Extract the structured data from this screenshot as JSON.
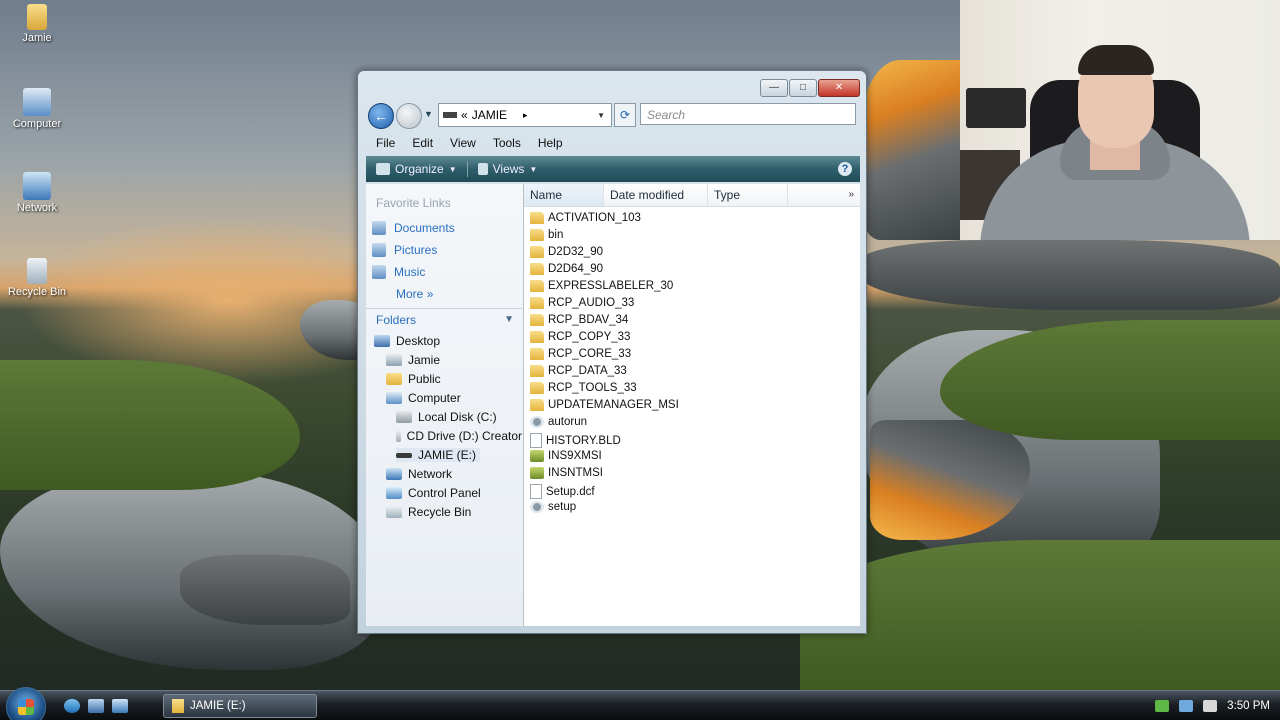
{
  "desktop": {
    "icons": [
      {
        "label": "Jamie",
        "icon": "user-folder-icon"
      },
      {
        "label": "Computer",
        "icon": "computer-icon"
      },
      {
        "label": "Network",
        "icon": "network-icon"
      },
      {
        "label": "Recycle Bin",
        "icon": "recycle-bin-icon"
      }
    ]
  },
  "window": {
    "caption_buttons": {
      "minimize": "—",
      "maximize": "□",
      "close": "✕"
    },
    "address": {
      "prefix": "«",
      "location": "JAMIE",
      "separator": "▸"
    },
    "search": {
      "placeholder": "Search"
    },
    "menu": [
      "File",
      "Edit",
      "View",
      "Tools",
      "Help"
    ],
    "toolbar": {
      "organize": "Organize",
      "views": "Views",
      "help": "?"
    },
    "favorite_links": {
      "title": "Favorite Links",
      "items": [
        "Documents",
        "Pictures",
        "Music"
      ],
      "more": "More"
    },
    "folders": {
      "title": "Folders",
      "tree": [
        {
          "label": "Desktop"
        },
        {
          "label": "Jamie"
        },
        {
          "label": "Public"
        },
        {
          "label": "Computer"
        },
        {
          "label": "Local Disk (C:)"
        },
        {
          "label": "CD Drive (D:) Creator"
        },
        {
          "label": "JAMIE (E:)"
        },
        {
          "label": "Network"
        },
        {
          "label": "Control Panel"
        },
        {
          "label": "Recycle Bin"
        }
      ]
    },
    "columns": [
      "Name",
      "Date modified",
      "Type"
    ],
    "files": [
      {
        "name": "ACTIVATION_103",
        "kind": "folder"
      },
      {
        "name": "bin",
        "kind": "folder"
      },
      {
        "name": "D2D32_90",
        "kind": "folder"
      },
      {
        "name": "D2D64_90",
        "kind": "folder"
      },
      {
        "name": "EXPRESSLABELER_30",
        "kind": "folder"
      },
      {
        "name": "RCP_AUDIO_33",
        "kind": "folder"
      },
      {
        "name": "RCP_BDAV_34",
        "kind": "folder"
      },
      {
        "name": "RCP_COPY_33",
        "kind": "folder"
      },
      {
        "name": "RCP_CORE_33",
        "kind": "folder"
      },
      {
        "name": "RCP_DATA_33",
        "kind": "folder"
      },
      {
        "name": "RCP_TOOLS_33",
        "kind": "folder"
      },
      {
        "name": "UPDATEMANAGER_MSI",
        "kind": "folder"
      },
      {
        "name": "autorun",
        "kind": "gear"
      },
      {
        "name": "HISTORY.BLD",
        "kind": "doc"
      },
      {
        "name": "INS9XMSI",
        "kind": "msi"
      },
      {
        "name": "INSNTMSI",
        "kind": "msi"
      },
      {
        "name": "Setup.dcf",
        "kind": "doc"
      },
      {
        "name": "setup",
        "kind": "gear"
      }
    ]
  },
  "taskbar": {
    "task": "JAMIE (E:)",
    "clock": "3:50 PM"
  }
}
